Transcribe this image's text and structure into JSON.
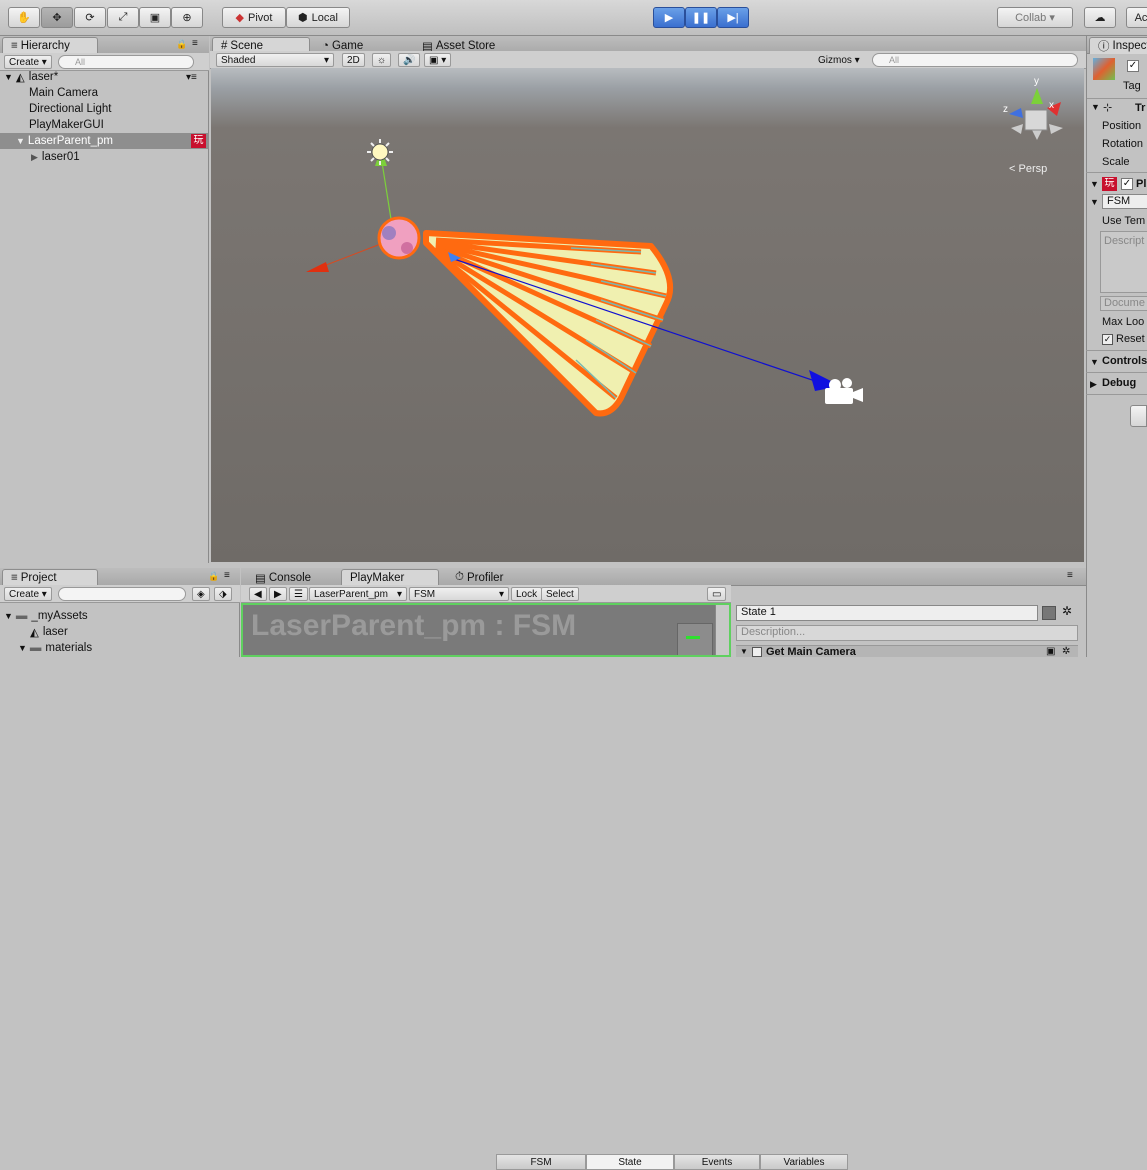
{
  "toolbar": {
    "pivot": "Pivot",
    "local": "Local",
    "collab": "Collab",
    "account": "Ac"
  },
  "hierarchy": {
    "tab": "Hierarchy",
    "create": "Create",
    "search_placeholder": "All",
    "scene_name": "laser*",
    "items": [
      "Main Camera",
      "Directional Light",
      "PlayMakerGUI",
      "LaserParent_pm"
    ],
    "child": "laser01",
    "playmaker_badge": "玩"
  },
  "scene": {
    "tabs": [
      "Scene",
      "Game",
      "Asset Store"
    ],
    "shading": "Shaded",
    "mode_2d": "2D",
    "gizmos": "Gizmos",
    "search_placeholder": "All",
    "persp": "Persp",
    "axis_x": "x",
    "axis_y": "y",
    "axis_z": "z"
  },
  "inspector": {
    "tab": "Inspect",
    "tag": "Tag",
    "transform_header": "Tr",
    "position": "Position",
    "rotation": "Rotation",
    "scale": "Scale",
    "pm_header": "Pl",
    "fsm": "FSM",
    "use_template": "Use Tem",
    "description": "Descript",
    "document": "Docume",
    "max_loop": "Max Loo",
    "reset": "Reset",
    "controls": "Controls",
    "debug": "Debug"
  },
  "project": {
    "tab": "Project",
    "create": "Create",
    "folders": [
      "_myAssets",
      "laser",
      "materials"
    ]
  },
  "bottom": {
    "tabs": [
      "Console",
      "PlayMaker",
      "Profiler"
    ],
    "object_select": "LaserParent_pm",
    "fsm_select": "FSM",
    "lock": "Lock",
    "select": "Select",
    "title": "LaserParent_pm : FSM",
    "right_tabs": [
      "FSM",
      "State",
      "Events",
      "Variables"
    ],
    "state_name": "State 1",
    "description_placeholder": "Description...",
    "action": "Get Main Camera"
  }
}
